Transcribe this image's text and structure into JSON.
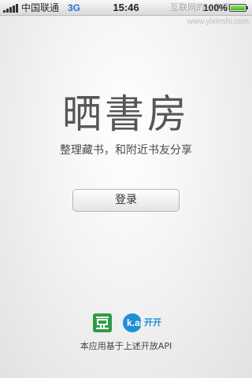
{
  "status_bar": {
    "carrier": "中国联通",
    "network": "3G",
    "time": "15:46",
    "watermark": "互联网的一些事",
    "battery_percent": "100%",
    "signal_icon": "signal-bars-icon",
    "battery_icon": "battery-full-icon"
  },
  "watermark_url": "www.yixieshi.com",
  "app": {
    "title": "晒書房",
    "tagline": "整理藏书，和附近书友分享",
    "login_label": "登录",
    "title_color": "#565656"
  },
  "footer": {
    "douban_logo": "douban-logo-icon",
    "douban_glyph": "豆",
    "kaikai_logo": "kaikai-logo-icon",
    "kaikai_mark": "k.ai",
    "kaikai_name": "开开",
    "powered_by": "本应用基于上述开放API",
    "douban_color": "#2e9c45",
    "kaikai_color": "#1f8fd6"
  }
}
